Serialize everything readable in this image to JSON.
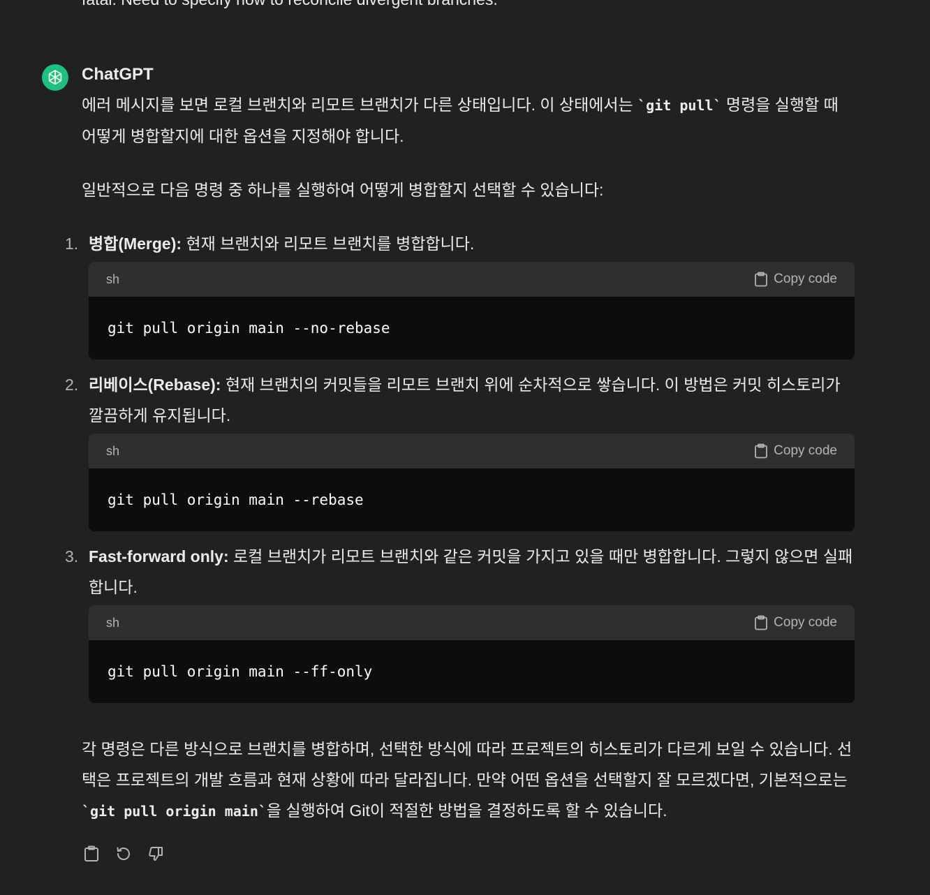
{
  "previous_text": "fatal: Need to specify how to reconcile divergent branches.",
  "message": {
    "author": "ChatGPT",
    "intro_line1_before": "에러 메시지를 보면 로컬 브랜치와 리모트 브랜치가 다른 상태입니다. 이 상태에서는 ",
    "intro_code": "`git pull`",
    "intro_line1_after": " 명령을 실행할 때 어떻게 병합할지에 대한 옵션을 지정해야 합니다.",
    "intro2": "일반적으로 다음 명령 중 하나를 실행하여 어떻게 병합할지 선택할 수 있습니다:",
    "items": [
      {
        "number": "1.",
        "title": "병합(Merge):",
        "text": " 현재 브랜치와 리모트 브랜치를 병합합니다.",
        "lang": "sh",
        "copy_label": "Copy code",
        "code": "git pull origin main --no-rebase"
      },
      {
        "number": "2.",
        "title": "리베이스(Rebase):",
        "text": " 현재 브랜치의 커밋들을 리모트 브랜치 위에 순차적으로 쌓습니다. 이 방법은 커밋 히스토리가 깔끔하게 유지됩니다.",
        "lang": "sh",
        "copy_label": "Copy code",
        "code": "git pull origin main --rebase"
      },
      {
        "number": "3.",
        "title": "Fast-forward only:",
        "text": " 로컬 브랜치가 리모트 브랜치와 같은 커밋을 가지고 있을 때만 병합합니다. 그렇지 않으면 실패합니다.",
        "lang": "sh",
        "copy_label": "Copy code",
        "code": "git pull origin main --ff-only"
      }
    ],
    "closing_before": "각 명령은 다른 방식으로 브랜치를 병합하며, 선택한 방식에 따라 프로젝트의 히스토리가 다르게 보일 수 있습니다. 선택은 프로젝트의 개발 흐름과 현재 상황에 따라 달라집니다. 만약 어떤 옵션을 선택할지 잘 모르겠다면, 기본적으로는 ",
    "closing_code": "`git pull origin main`",
    "closing_after": "을 실행하여 Git이 적절한 방법을 결정하도록 할 수 있습니다."
  },
  "actions": [
    "copy-icon",
    "regenerate-icon",
    "thumbs-down-icon"
  ],
  "colors": {
    "background": "#212121",
    "code_header": "#2f2f2f",
    "code_body": "#0d0d0d",
    "avatar": "#19c37d"
  }
}
